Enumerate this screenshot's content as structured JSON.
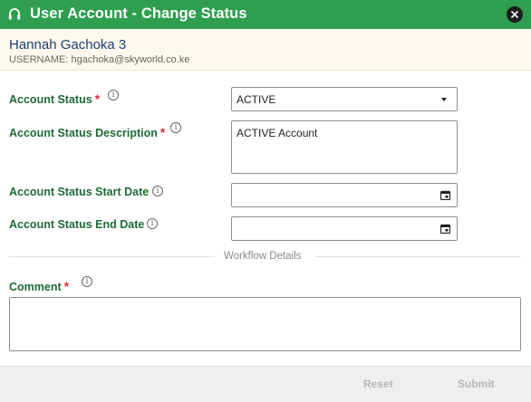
{
  "dialog": {
    "title": "User Account - Change Status",
    "header_icon": "headset-icon",
    "close_icon": "close-icon",
    "brand_color": "#2f9e4f"
  },
  "user": {
    "name": "Hannah Gachoka 3",
    "username_line": "USERNAME: hgachoka@skyworld.co.ke"
  },
  "form": {
    "required_mark": "*",
    "info_glyph": "i",
    "account_status": {
      "label": "Account Status",
      "required": true,
      "value": "ACTIVE"
    },
    "account_status_description": {
      "label": "Account Status Description",
      "required": true,
      "value": "ACTIVE Account"
    },
    "start_date": {
      "label": "Account Status Start Date",
      "value": ""
    },
    "end_date": {
      "label": "Account Status End Date",
      "value": ""
    },
    "workflow_divider": "Workflow Details",
    "comment": {
      "label": "Comment",
      "required": true,
      "value": ""
    }
  },
  "footer": {
    "reset_label": "Reset",
    "submit_label": "Submit"
  }
}
